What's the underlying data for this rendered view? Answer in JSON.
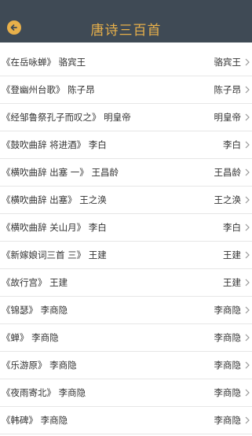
{
  "header": {
    "title": "唐诗三百首",
    "back_icon": "back-arrow-icon"
  },
  "rows": [
    {
      "left": "《在岳咏蝉》  骆宾王",
      "right": "骆宾王"
    },
    {
      "left": "《登幽州台歌》  陈子昂",
      "right": "陈子昂"
    },
    {
      "left": "《经邹鲁祭孔子而叹之》  明皇帝",
      "right": "明皇帝"
    },
    {
      "left": "《鼓吹曲辞 将进酒》  李白",
      "right": "李白"
    },
    {
      "left": "《横吹曲辞 出塞 一》  王昌龄",
      "right": "王昌龄"
    },
    {
      "left": "《横吹曲辞 出塞》  王之涣",
      "right": "王之涣"
    },
    {
      "left": "《横吹曲辞 关山月》  李白",
      "right": "李白"
    },
    {
      "left": "《新嫁娘词三首 三》  王建",
      "right": "王建"
    },
    {
      "left": "《故行宫》  王建",
      "right": "王建"
    },
    {
      "left": "《锦瑟》  李商隐",
      "right": "李商隐"
    },
    {
      "left": "《蝉》  李商隐",
      "right": "李商隐"
    },
    {
      "left": "《乐游原》  李商隐",
      "right": "李商隐"
    },
    {
      "left": "《夜雨寄北》  李商隐",
      "right": "李商隐"
    },
    {
      "left": "《韩碑》  李商隐",
      "right": "李商隐"
    }
  ],
  "colors": {
    "header_bg": "#3f4a55",
    "accent": "#e8b04a"
  }
}
